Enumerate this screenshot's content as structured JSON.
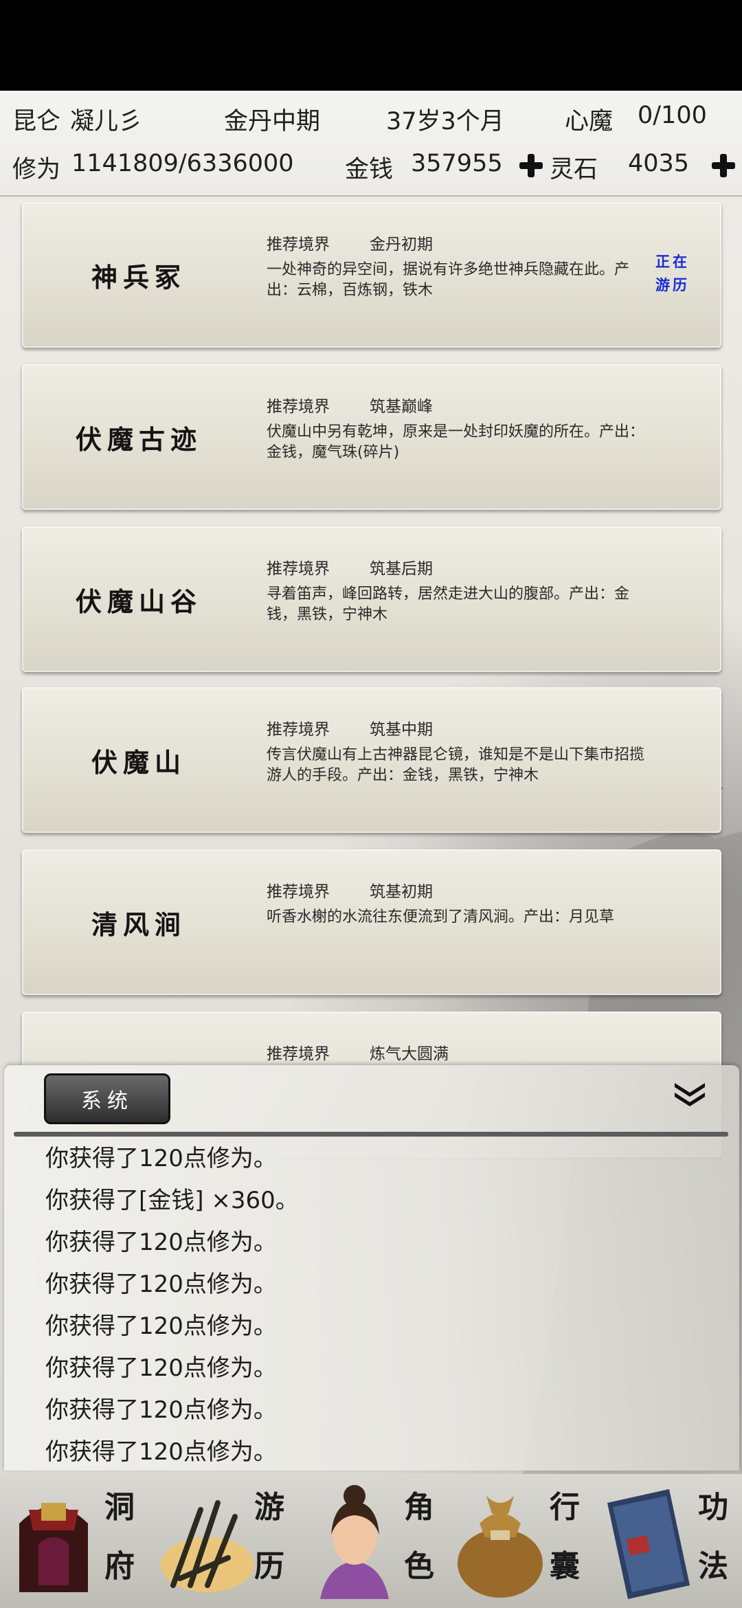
{
  "header": {
    "location": "昆仑",
    "name": "凝儿彡",
    "realm": "金丹中期",
    "age": "37岁3个月",
    "demon_label": "心魔",
    "demon_value": "0/100",
    "cultivation_label": "修为",
    "cultivation_value": "1141809/6336000",
    "money_label": "金钱",
    "money_value": "357955",
    "spirit_stone_label": "灵石",
    "spirit_stone_value": "4035"
  },
  "locations": [
    {
      "name": "神兵冢",
      "realm_label": "推荐境界",
      "realm": "金丹初期",
      "desc": "一处神奇的异空间，据说有许多绝世神兵隐藏在此。产出：云棉，百炼钢，铁木",
      "status": "正在游历"
    },
    {
      "name": "伏魔古迹",
      "realm_label": "推荐境界",
      "realm": "筑基巅峰",
      "desc": "伏魔山中另有乾坤，原来是一处封印妖魔的所在。产出：金钱，魔气珠(碎片)",
      "status": ""
    },
    {
      "name": "伏魔山谷",
      "realm_label": "推荐境界",
      "realm": "筑基后期",
      "desc": "寻着笛声，峰回路转，居然走进大山的腹部。产出：金钱，黑铁，宁神木",
      "status": ""
    },
    {
      "name": "伏魔山",
      "realm_label": "推荐境界",
      "realm": "筑基中期",
      "desc": "传言伏魔山有上古神器昆仑镜，谁知是不是山下集市招揽游人的手段。产出：金钱，黑铁，宁神木",
      "status": ""
    },
    {
      "name": "清风涧",
      "realm_label": "推荐境界",
      "realm": "筑基初期",
      "desc": "听香水榭的水流往东便流到了清风涧。产出：月见草",
      "status": ""
    },
    {
      "name": "",
      "realm_label": "推荐境界",
      "realm": "炼气大圆满",
      "desc": "",
      "status": ""
    }
  ],
  "log": {
    "tab_label": "系统",
    "lines": [
      "你获得了120点修为。",
      "你获得了[金钱] ×360。",
      "你获得了120点修为。",
      "你获得了120点修为。",
      "你获得了120点修为。",
      "你获得了120点修为。",
      "你获得了120点修为。",
      "你获得了120点修为。"
    ]
  },
  "nav": [
    {
      "label_top": "洞",
      "label_bottom": "府",
      "icon": "cave-dwelling-icon"
    },
    {
      "label_top": "游",
      "label_bottom": "历",
      "icon": "travel-icon"
    },
    {
      "label_top": "角",
      "label_bottom": "色",
      "icon": "character-icon"
    },
    {
      "label_top": "行",
      "label_bottom": "囊",
      "icon": "bag-icon"
    },
    {
      "label_top": "功",
      "label_bottom": "法",
      "icon": "skill-book-icon"
    }
  ],
  "colors": {
    "status_blue": "#1a2ad6",
    "active_nav_glow": "#f3c46a"
  }
}
